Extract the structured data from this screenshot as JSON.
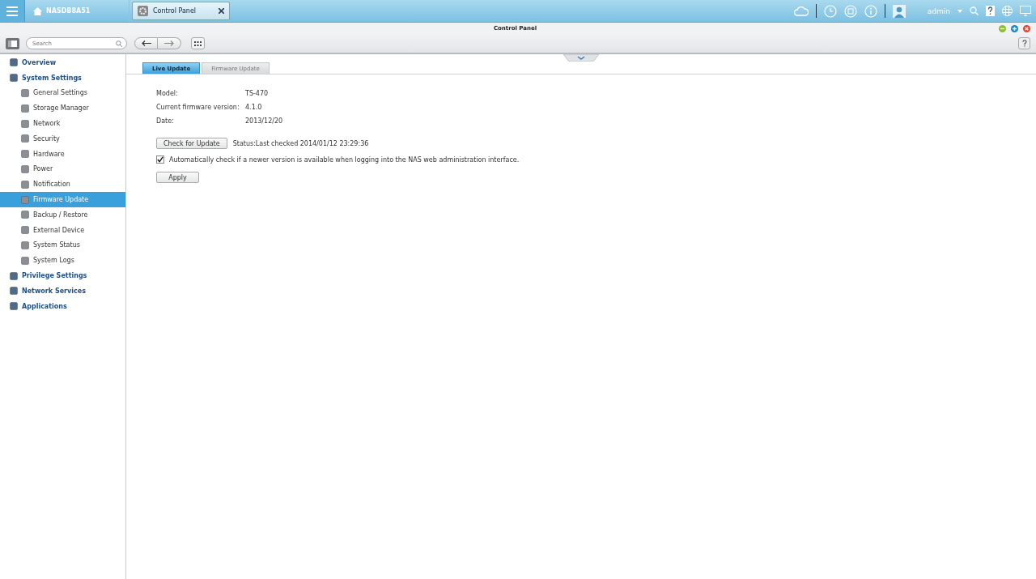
{
  "top_bar": {
    "host": "NASDB8A51",
    "tabs": [
      {
        "label": "Control Panel",
        "selected": true
      }
    ],
    "user": "admin"
  },
  "window": {
    "title": "Control Panel"
  },
  "toolbar": {
    "search": {
      "placeholder": "Search"
    }
  },
  "sidebar": {
    "items": [
      {
        "label": "Overview",
        "selected": false
      },
      {
        "label": "System Settings",
        "selected": false,
        "children": [
          {
            "label": "General Settings",
            "selected": false
          },
          {
            "label": "Storage Manager",
            "selected": false
          },
          {
            "label": "Network",
            "selected": false
          },
          {
            "label": "Security",
            "selected": false
          },
          {
            "label": "Hardware",
            "selected": false
          },
          {
            "label": "Power",
            "selected": false
          },
          {
            "label": "Notification",
            "selected": false
          },
          {
            "label": "Firmware Update",
            "selected": true
          },
          {
            "label": "Backup / Restore",
            "selected": false
          },
          {
            "label": "External Device",
            "selected": false
          },
          {
            "label": "System Status",
            "selected": false
          },
          {
            "label": "System Logs",
            "selected": false
          }
        ]
      },
      {
        "label": "Privilege Settings",
        "selected": false
      },
      {
        "label": "Network Services",
        "selected": false
      },
      {
        "label": "Applications",
        "selected": false
      }
    ]
  },
  "content": {
    "tabs": [
      {
        "label": "Live Update",
        "selected": true
      },
      {
        "label": "Firmware Update",
        "selected": false
      }
    ],
    "fields": [
      {
        "label": "Model:",
        "value": "TS-470"
      },
      {
        "label": "Current firmware version:",
        "value": "4.1.0"
      },
      {
        "label": "Date:",
        "value": "2013/12/20"
      }
    ],
    "check_button": "Check for Update",
    "status": "Status:Last checked 2014/01/12 23:29:36",
    "auto_check": {
      "label": "Automatically check if a newer version is available when logging into the NAS web administration interface.",
      "checked": true
    },
    "apply_button": "Apply"
  }
}
